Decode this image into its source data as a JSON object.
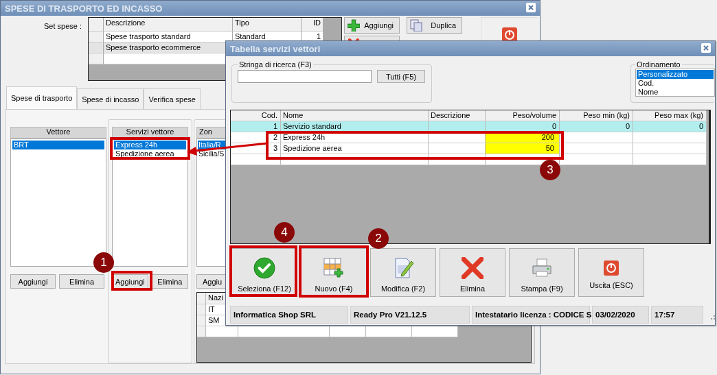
{
  "main_window": {
    "title": "SPESE DI TRASPORTO ED INCASSO",
    "set_spese": {
      "label": "Set spese :",
      "columns": [
        "Descrizione",
        "Tipo",
        "ID"
      ],
      "rows": [
        {
          "descrizione": "Spese trasporto standard",
          "tipo": "Standard",
          "id": "1",
          "selected": false
        },
        {
          "descrizione": "Spese trasporto ecommerce",
          "selected": true
        }
      ]
    },
    "toolbar": [
      {
        "kind": "add",
        "label": "Aggiungi"
      },
      {
        "kind": "copy",
        "label": "Duplica"
      },
      {
        "kind": "delete"
      }
    ],
    "tabs": [
      {
        "label": "Spese di trasporto",
        "selected": true
      },
      {
        "label": "Spese di incasso",
        "selected": false
      },
      {
        "label": "Verifica spese",
        "selected": false
      }
    ],
    "vettore": {
      "header": "Vettore",
      "items": [
        {
          "label": "BRT",
          "selected": true
        }
      ],
      "buttons": [
        "Aggiungi",
        "Elimina"
      ]
    },
    "servizi": {
      "header": "Servizi vettore",
      "items": [
        {
          "label": "Express 24h",
          "selected": true
        },
        {
          "label": "Spedizione aerea",
          "selected": false
        }
      ],
      "buttons": [
        "Aggiungi",
        "Elimina"
      ]
    },
    "zone": {
      "header": "Zon",
      "items": [
        {
          "label": "Italia/R",
          "selected": true
        },
        {
          "label": "Sicilia/S",
          "selected": false
        }
      ],
      "buttons": [
        "Aggiu"
      ],
      "nazioni": {
        "column": "Nazi",
        "rows": [
          "IT",
          "SM"
        ]
      }
    }
  },
  "dialog": {
    "title": "Tabella servizi vettori",
    "search": {
      "legend": "Stringa di ricerca (F3)",
      "button": "Tutti (F5)"
    },
    "sort": {
      "legend": "Ordinamento",
      "options": [
        {
          "label": "Personalizzato",
          "selected": true
        },
        {
          "label": "Cod.",
          "selected": false
        },
        {
          "label": "Nome",
          "selected": false
        }
      ]
    },
    "table": {
      "columns": [
        "Cod.",
        "Nome",
        "Descrizione",
        "Peso/volume",
        "Peso min (kg)",
        "Peso max (kg)"
      ],
      "rows": [
        {
          "cod": "1",
          "nome": "Servizio standard",
          "peso_volume": "0",
          "peso_min": "0",
          "peso_max": "0",
          "selected": true,
          "highlighted": false
        },
        {
          "cod": "2",
          "nome": "Express 24h",
          "peso_volume": "200",
          "selected": false,
          "highlighted": true
        },
        {
          "cod": "3",
          "nome": "Spedizione aerea",
          "peso_volume": "50",
          "selected": false,
          "highlighted": true
        }
      ]
    },
    "actions": [
      {
        "kind": "select",
        "label": "Seleziona (F12)"
      },
      {
        "kind": "new",
        "label": "Nuovo (F4)"
      },
      {
        "kind": "edit",
        "label": "Modifica (F2)"
      },
      {
        "kind": "delete",
        "label": "Elimina"
      },
      {
        "kind": "print",
        "label": "Stampa (F9)"
      },
      {
        "kind": "exit",
        "label": "Uscita (ESC)"
      }
    ],
    "status_bar": [
      "Informatica Shop SRL",
      "Ready Pro V21.12.5",
      "Intestatario licenza : CODICE S",
      "03/02/2020",
      "17:57"
    ]
  },
  "callouts": [
    {
      "number": "1"
    },
    {
      "number": "2"
    },
    {
      "number": "3"
    },
    {
      "number": "4"
    }
  ]
}
